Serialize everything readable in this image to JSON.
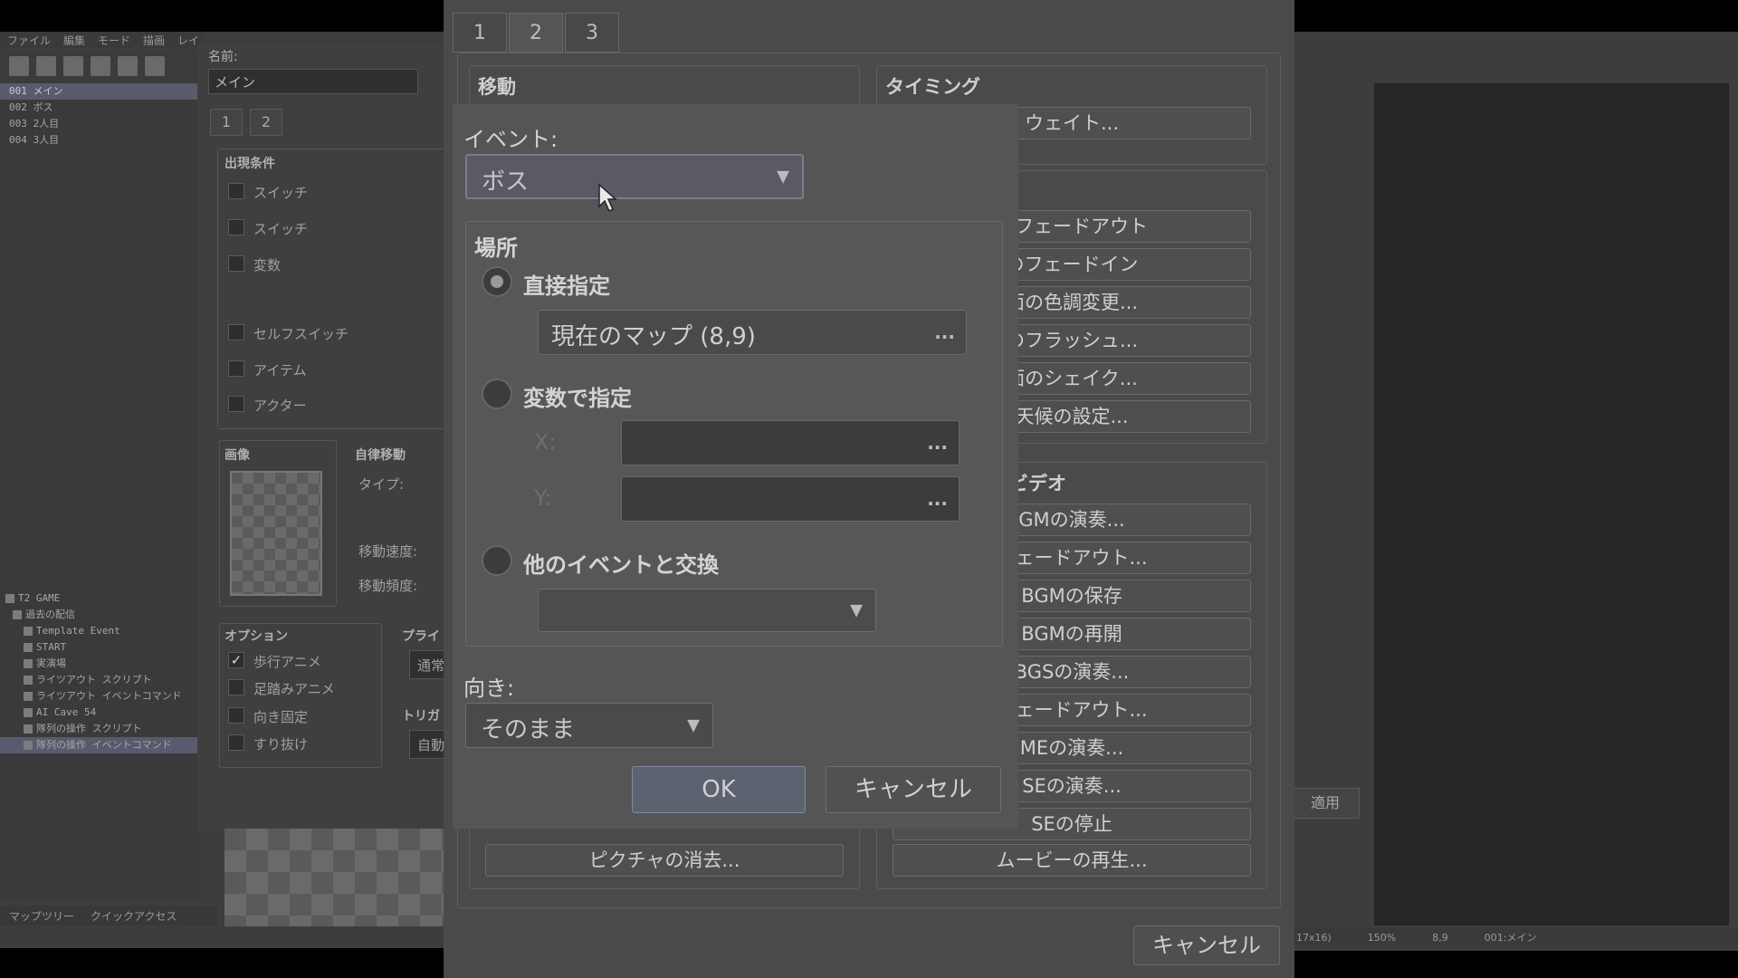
{
  "editor": {
    "menu": [
      "ファイル",
      "編集",
      "モード",
      "描画",
      "レイ"
    ],
    "events": [
      "001 メイン",
      "002 ボス",
      "003 2人目",
      "004 3人目"
    ],
    "tree": [
      "T2 GAME",
      "過去の配信",
      "Template Event",
      "START",
      "実演場",
      "ライツアウト スクリプト",
      "ライツアウト イベントコマンド",
      "AI Cave 54",
      "隊列の操作 スクリプト",
      "隊列の操作 イベントコマンド"
    ],
    "bottom_tabs": [
      "マップツリー",
      "クイックアクセス"
    ],
    "status": [
      "17x16)",
      "150%",
      "8,9",
      "001:メイン"
    ],
    "apply_label": "適用"
  },
  "event_editor": {
    "name_label": "名前:",
    "name_value": "メイン",
    "page_tabs": [
      "1",
      "2"
    ],
    "conditions_title": "出現条件",
    "conditions": [
      "スイッチ",
      "スイッチ",
      "変数",
      "セルフスイッチ",
      "アイテム",
      "アクター"
    ],
    "image_title": "画像",
    "autonomous_title": "自律移動",
    "auto_labels": [
      "タイプ:",
      "移動速度:",
      "移動頻度:"
    ],
    "options_title": "オプション",
    "options": [
      {
        "label": "歩行アニメ",
        "checked": true
      },
      {
        "label": "足踏みアニメ",
        "checked": false
      },
      {
        "label": "向き固定",
        "checked": false
      },
      {
        "label": "すり抜け",
        "checked": false
      }
    ],
    "priority_title": "プライ",
    "priority_value": "通常",
    "trigger_title": "トリガ",
    "trigger_value": "自動"
  },
  "command_dialog": {
    "tabs": [
      "1",
      "2",
      "3"
    ],
    "movement_title": "移動",
    "timing_title": "タイミング",
    "timing_buttons": [
      "ウェイト..."
    ],
    "screen_buttons": [
      "のフェードアウト",
      "のフェードイン",
      "面の色調変更...",
      "のフラッシュ...",
      "面のシェイク...",
      "天候の設定..."
    ],
    "audio_title": "ビデオ",
    "audio_buttons": [
      "GMの演奏...",
      "フェードアウト...",
      "BGMの保存",
      "BGMの再開",
      "BGSの演奏...",
      "フェードアウト...",
      "MEの演奏...",
      "SEの演奏...",
      "SEの停止",
      "ムービーの再生..."
    ],
    "picture_buttons": [
      "ピクチャの消去..."
    ],
    "cancel_label": "キャンセル"
  },
  "transfer_dialog": {
    "event_label": "イベント:",
    "event_value": "ボス",
    "location_title": "場所",
    "option_direct": "直接指定",
    "direct_value": "現在のマップ (8,9)",
    "option_variable": "変数で指定",
    "x_label": "X:",
    "y_label": "Y:",
    "option_exchange": "他のイベントと交換",
    "exchange_value": "",
    "direction_label": "向き:",
    "direction_value": "そのまま",
    "ok_label": "OK",
    "cancel_label": "キャンセル",
    "dots": "..."
  }
}
